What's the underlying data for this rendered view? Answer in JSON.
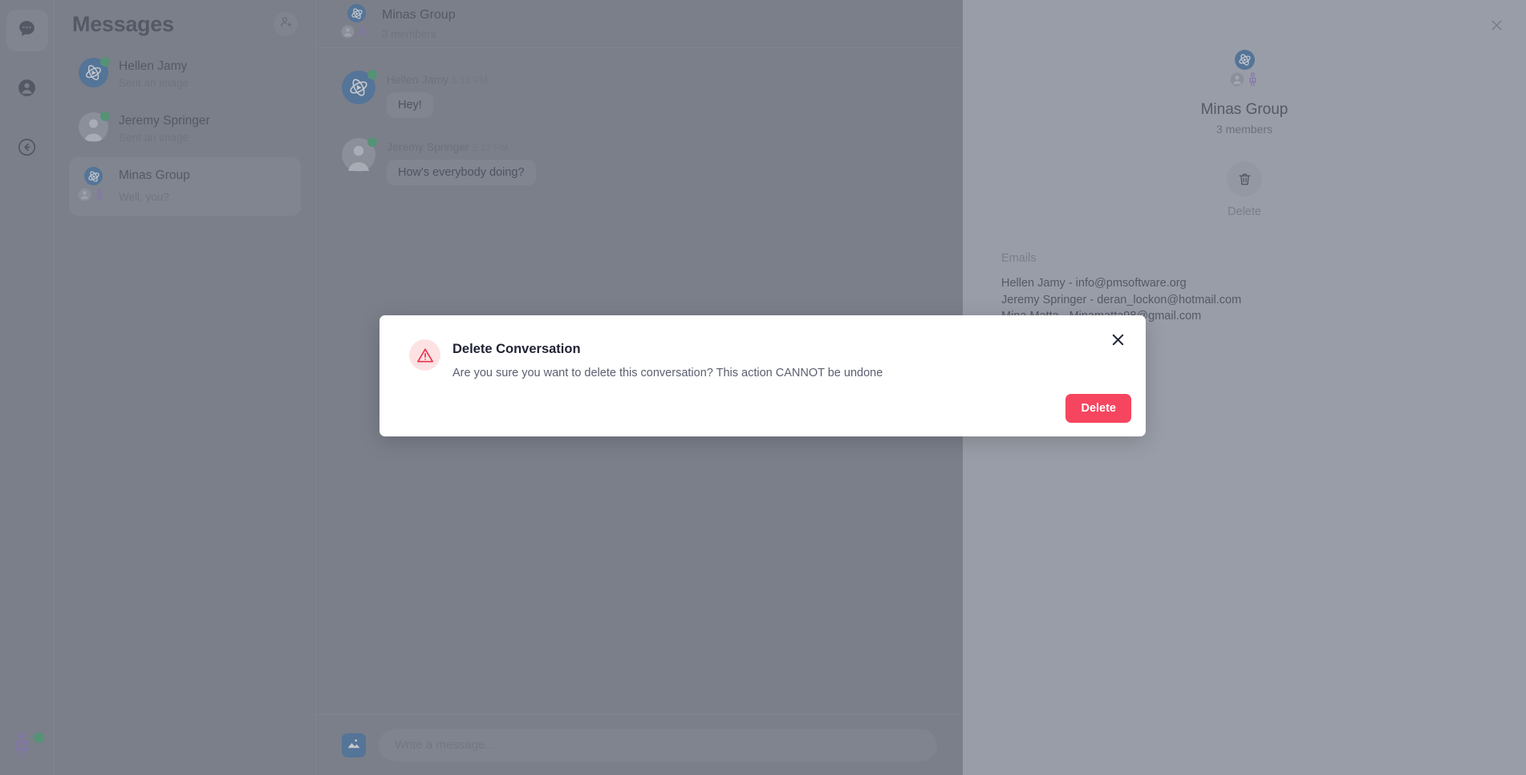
{
  "colors": {
    "app_bg": "#7E828D",
    "details_bg": "#B1B5BF",
    "accent_blue": "#3C6FA5",
    "online_green": "#3DA36B",
    "danger_red": "#F6455F",
    "warn_icon_bg": "#FDE2E4",
    "modal_bg": "#FFFFFF",
    "selected_row": "#888C96",
    "purple_person": "#8C6FC4"
  },
  "rail": {
    "items": [
      {
        "name": "chat-bubble-icon",
        "active": true
      },
      {
        "name": "profile-icon",
        "active": false
      },
      {
        "name": "back-arrow-icon",
        "active": false
      }
    ],
    "avatar_icon": "person-icon",
    "avatar_status": "online"
  },
  "sidebar": {
    "title": "Messages",
    "add_user_icon": "add-user-icon",
    "conversations": [
      {
        "name": "Hellen Jamy",
        "preview": "Sent an image",
        "avatar": "atom-logo-avatar",
        "avatar_style": "blue",
        "online": true,
        "group": false,
        "selected": false
      },
      {
        "name": "Jeremy Springer",
        "preview": "Sent an image",
        "avatar": "person-avatar",
        "avatar_style": "grey",
        "online": true,
        "group": false,
        "selected": false
      },
      {
        "name": "Minas Group",
        "preview": "Well, you?",
        "avatar": "atom-logo-avatar",
        "avatar_style": "blue",
        "online": false,
        "group": true,
        "selected": true
      }
    ]
  },
  "chat": {
    "header": {
      "title": "Minas Group",
      "subtitle": "3 members",
      "avatar": "atom-logo-avatar"
    },
    "messages": [
      {
        "sender": "Hellen Jamy",
        "time": "5:12 PM",
        "text": "Hey!",
        "avatar": "atom-logo-avatar",
        "avatar_style": "blue",
        "online": true
      },
      {
        "sender": "Jeremy Springer",
        "time": "5:12 PM",
        "text": "How's everybody doing?",
        "avatar": "person-avatar",
        "avatar_style": "grey",
        "online": true
      }
    ],
    "composer": {
      "image_button_icon": "image-icon",
      "input_value": "",
      "input_placeholder": "Write a message..."
    }
  },
  "details": {
    "close_icon": "close-icon",
    "title": "Minas Group",
    "members": "3 members",
    "delete": {
      "icon": "trash-icon",
      "label": "Delete"
    },
    "emails_title": "Emails",
    "emails": [
      "Hellen Jamy - info@pmsoftware.org",
      "Jeremy Springer - deran_lockon@hotmail.com",
      "Mina Matta - Minamatta98@gmail.com"
    ]
  },
  "modal": {
    "visible": true,
    "warn_icon": "warning-triangle-icon",
    "title": "Delete Conversation",
    "message": "Are you sure you want to delete this conversation? This action CANNOT be undone",
    "close_icon": "close-icon",
    "confirm_label": "Delete"
  }
}
